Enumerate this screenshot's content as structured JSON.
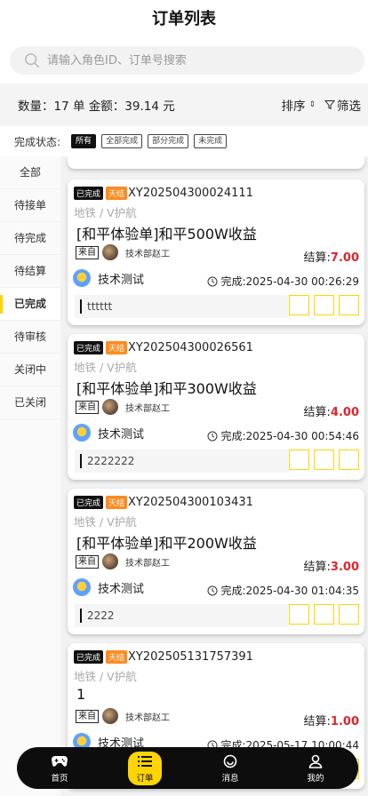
{
  "title": "订单列表",
  "search": {
    "placeholder": "请输入角色ID、订单号搜索"
  },
  "summary": {
    "stats": "数量：17 单  金额：39.14 元",
    "sort_label": "排序",
    "filter_label": "筛选"
  },
  "status_filter": {
    "label": "完成状态:",
    "chips": [
      "所有",
      "全部完成",
      "部分完成",
      "未完成"
    ],
    "active_index": 0
  },
  "sidebar": {
    "items": [
      "全部",
      "待接单",
      "待完成",
      "待结算",
      "已完成",
      "待审核",
      "关闭中",
      "已关闭"
    ],
    "active_index": 4
  },
  "orders": [
    {
      "status_badge": "已完成",
      "settle_badge": "天结",
      "order_no": "XY202504300024111",
      "category": "地铁 / V护航",
      "product_title": "[和平体验单]和平500W收益",
      "from_label": "来自",
      "publisher": "技术部赵工",
      "settle_label": "结算:",
      "settle_amount": "7.00",
      "worker": "技术测试",
      "completed_at": "完成:2025-04-30 00:26:29",
      "note": "tttttt"
    },
    {
      "status_badge": "已完成",
      "settle_badge": "天结",
      "order_no": "XY202504300026561",
      "category": "地铁 / V护航",
      "product_title": "[和平体验单]和平300W收益",
      "from_label": "来自",
      "publisher": "技术部赵工",
      "settle_label": "结算:",
      "settle_amount": "4.00",
      "worker": "技术测试",
      "completed_at": "完成:2025-04-30 00:54:46",
      "note": "2222222"
    },
    {
      "status_badge": "已完成",
      "settle_badge": "天结",
      "order_no": "XY202504300103431",
      "category": "地铁 / V护航",
      "product_title": "[和平体验单]和平200W收益",
      "from_label": "来自",
      "publisher": "技术部赵工",
      "settle_label": "结算:",
      "settle_amount": "3.00",
      "worker": "技术测试",
      "completed_at": "完成:2025-04-30 01:04:35",
      "note": "2222"
    },
    {
      "status_badge": "已完成",
      "settle_badge": "天结",
      "order_no": "XY202505131757391",
      "category": "地铁 / V护航",
      "product_title": "1",
      "from_label": "来自",
      "publisher": "技术部赵工",
      "settle_label": "结算:",
      "settle_amount": "1.00",
      "worker": "技术测试",
      "completed_at": "完成:2025-05-17 10:00:44",
      "note": ""
    }
  ],
  "bottom_nav": {
    "items": [
      {
        "label": "首页",
        "icon": "gamepad-icon"
      },
      {
        "label": "订单",
        "icon": "list-icon"
      },
      {
        "label": "消息",
        "icon": "message-icon"
      },
      {
        "label": "我的",
        "icon": "user-icon"
      }
    ],
    "active_index": 1
  },
  "colors": {
    "accent": "#ffd400",
    "settle_badge": "#ff8a1f",
    "amount": "#e0242b",
    "nav_bg": "#0d0d0d"
  }
}
